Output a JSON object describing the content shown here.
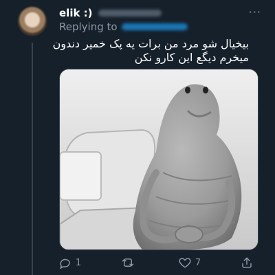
{
  "tweet": {
    "author_name": "elik :)",
    "replying_label": "Replying to",
    "more_icon": "···",
    "text_lines": [
      "بیخیال شو مرد من برات یه پک خمیر دندون",
      "میخرم دیگع این کارو نکن"
    ],
    "media": {
      "description": "Grayscale photo of Ždun sculpture seated in a chair"
    },
    "actions": {
      "reply_count": "1",
      "retweet_count": "",
      "like_count": "7",
      "share_label": ""
    },
    "colors": {
      "background": "#15202b",
      "secondary_text": "#8b98a5",
      "divider": "#38444d",
      "accent": "#1d9bf0"
    }
  }
}
